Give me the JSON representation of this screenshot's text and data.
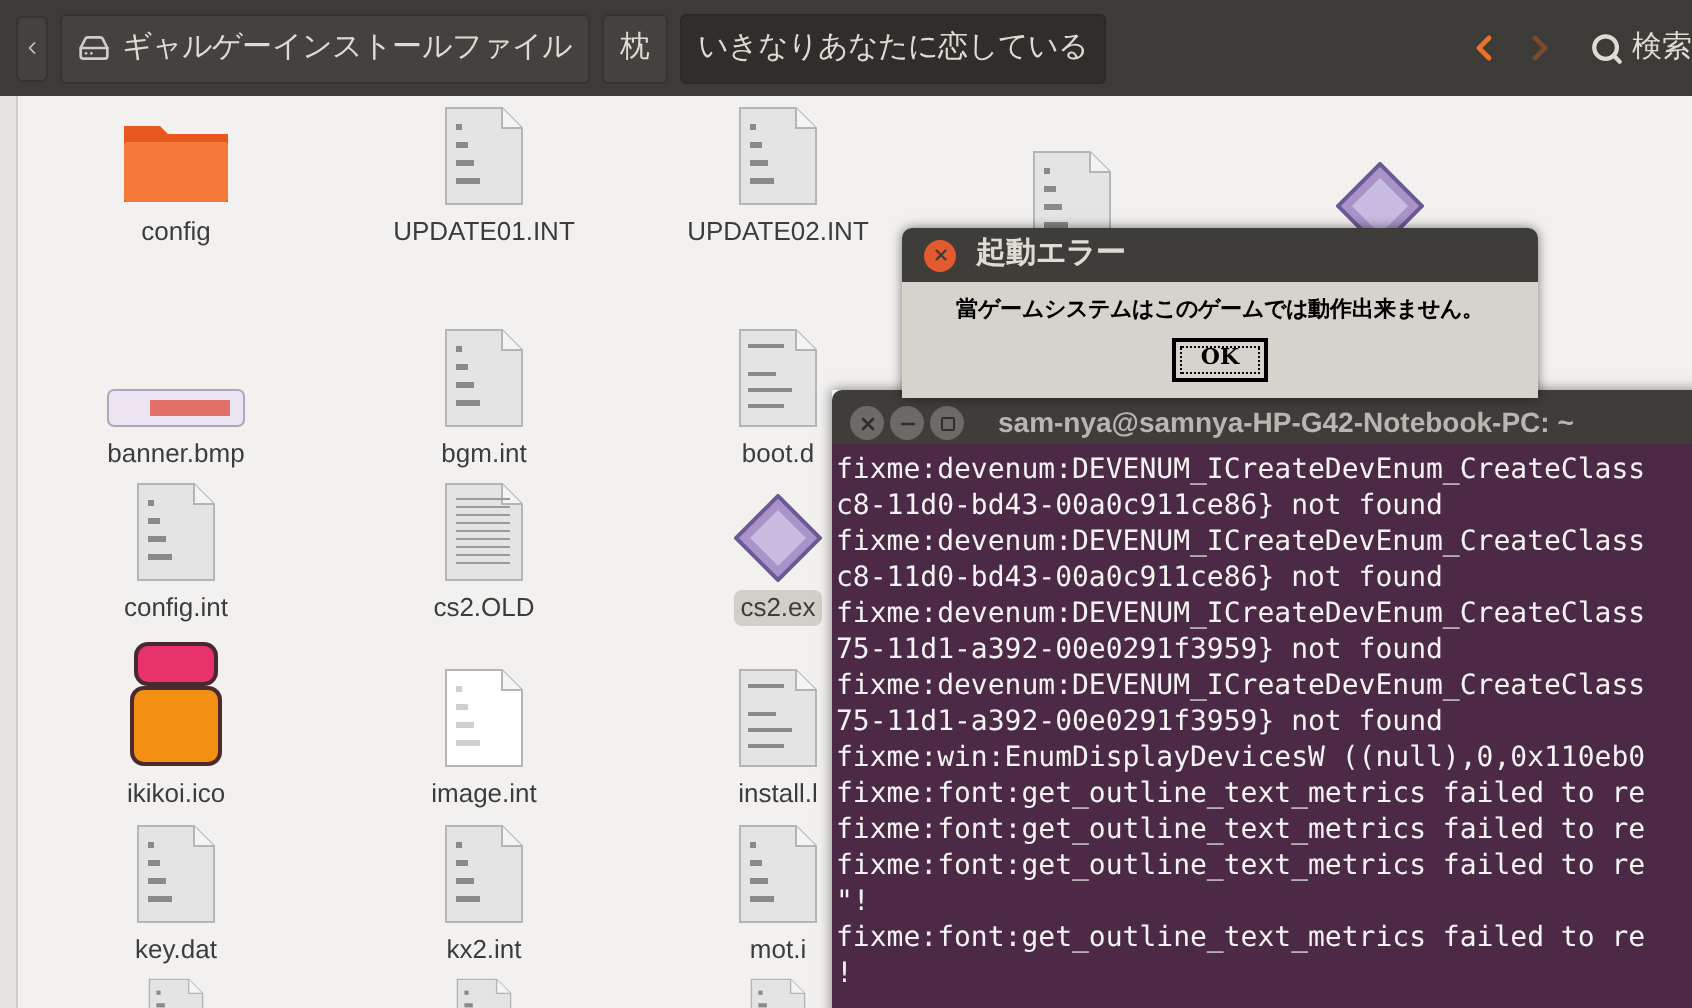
{
  "toolbar": {
    "breadcrumbs": [
      {
        "label": "ギャルゲーインストールファイル",
        "kind": "drive",
        "selected": false
      },
      {
        "label": "枕",
        "kind": "folder",
        "selected": false
      },
      {
        "label": "いきなりあなたに恋している",
        "kind": "folder",
        "selected": true
      }
    ],
    "nav": [
      {
        "kind": "back",
        "disabled": false
      },
      {
        "kind": "forward",
        "disabled": true
      }
    ],
    "search_label": "検索"
  },
  "files": [
    [
      {
        "name": "config",
        "kind": "folder",
        "selected": false
      },
      {
        "name": "UPDATE01.INT",
        "kind": "binary",
        "selected": false
      },
      {
        "name": "UPDATE02.INT",
        "kind": "binary",
        "selected": false
      },
      {
        "kind": "binary"
      },
      {
        "kind": "exe"
      }
    ],
    [
      {
        "name": "banner.bmp",
        "kind": "banner",
        "selected": false
      },
      {
        "name": "bgm.int",
        "kind": "binary",
        "selected": false
      },
      {
        "name": "boot.d",
        "kind": "script",
        "selected": false
      }
    ],
    [
      {
        "name": "config.int",
        "kind": "binary",
        "selected": false
      },
      {
        "name": "cs2.OLD",
        "kind": "document",
        "selected": false
      },
      {
        "name": "cs2.ex",
        "kind": "exe",
        "selected": true
      }
    ],
    [
      {
        "name": "ikikoi.ico",
        "kind": "ico",
        "selected": false
      },
      {
        "name": "image.int",
        "kind": "binary_light",
        "selected": false
      },
      {
        "name": "install.l",
        "kind": "script",
        "selected": false
      }
    ],
    [
      {
        "name": "key.dat",
        "kind": "binary",
        "selected": false
      },
      {
        "name": "kx2.int",
        "kind": "binary",
        "selected": false
      },
      {
        "name": "mot.i",
        "kind": "binary",
        "selected": false
      }
    ],
    [
      {
        "kind": "binary"
      },
      {
        "kind": "binary"
      },
      {
        "kind": "binary"
      }
    ]
  ],
  "dialog": {
    "title": "起動エラー",
    "message": "當ゲームシステムはこのゲームでは動作出来ません。",
    "button": "OK"
  },
  "terminal": {
    "title": "sam-nya@samnya-HP-G42-Notebook-PC: ~",
    "lines": [
      "fixme:devenum:DEVENUM_ICreateDevEnum_CreateClass",
      "c8-11d0-bd43-00a0c911ce86} not found",
      "fixme:devenum:DEVENUM_ICreateDevEnum_CreateClass",
      "c8-11d0-bd43-00a0c911ce86} not found",
      "fixme:devenum:DEVENUM_ICreateDevEnum_CreateClass",
      "75-11d1-a392-00e0291f3959} not found",
      "fixme:devenum:DEVENUM_ICreateDevEnum_CreateClass",
      "75-11d1-a392-00e0291f3959} not found",
      "fixme:win:EnumDisplayDevicesW ((null),0,0x110eb0",
      "fixme:font:get_outline_text_metrics failed to re",
      "fixme:font:get_outline_text_metrics failed to re",
      "fixme:font:get_outline_text_metrics failed to re",
      "\"!",
      "fixme:font:get_outline_text_metrics failed to re",
      "!"
    ]
  }
}
